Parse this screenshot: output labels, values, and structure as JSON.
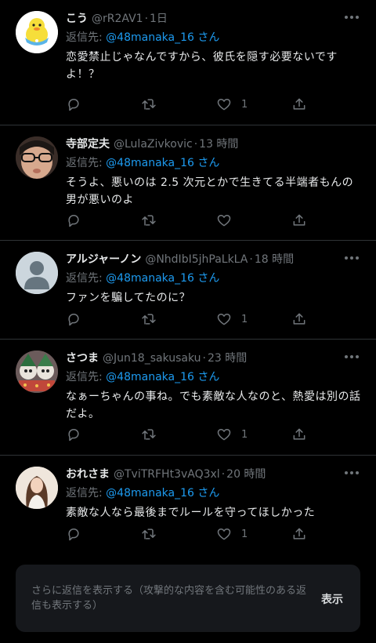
{
  "replies": [
    {
      "name": "こう",
      "handle": "@rR2AV1",
      "time": "1日",
      "reply_to_prefix": "返信先:",
      "reply_to": "@48manaka_16",
      "reply_to_suffix": "さん",
      "text": "恋愛禁止じゃなんですから、彼氏を隠す必要ないですよ！？",
      "likes": "1",
      "avatar": "duck-avatar"
    },
    {
      "name": "寺部定夫",
      "handle": "@LulaZivkovic",
      "time": "13 時間",
      "reply_to_prefix": "返信先:",
      "reply_to": "@48manaka_16",
      "reply_to_suffix": "さん",
      "text": "そうよ、悪いのは 2.5 次元とかで生きてる半端者もんの男が悪いのよ",
      "likes": "",
      "avatar": "photo-avatar"
    },
    {
      "name": "アルジャーノン",
      "handle": "@NhdIbI5jhPaLkLA",
      "time": "18 時間",
      "reply_to_prefix": "返信先:",
      "reply_to": "@48manaka_16",
      "reply_to_suffix": "さん",
      "text": "ファンを騙してたのに？",
      "likes": "1",
      "avatar": "default-avatar"
    },
    {
      "name": "さつま",
      "handle": "@Jun18_sakusaku",
      "time": "23 時間",
      "reply_to_prefix": "返信先:",
      "reply_to": "@48manaka_16",
      "reply_to_suffix": "さん",
      "text": "なぁーちゃんの事ね。でも素敵な人なのと、熱愛は別の話だよ。",
      "likes": "1",
      "avatar": "figurines-avatar"
    },
    {
      "name": "おれさま",
      "handle": "@TviTRFHt3vAQ3xl",
      "time": "20 時間",
      "reply_to_prefix": "返信先:",
      "reply_to": "@48manaka_16",
      "reply_to_suffix": "さん",
      "text": "素敵な人なら最後までルールを守ってほしかった",
      "likes": "1",
      "avatar": "person-avatar"
    }
  ],
  "more_replies": {
    "label": "さらに返信を表示する（攻撃的な内容を含む可能性のある返信も表示する）",
    "button": "表示"
  },
  "colors": {
    "background": "#000000",
    "text": "#e7e9ea",
    "muted": "#71767b",
    "link": "#1d9bf0",
    "divider": "#2f3336"
  }
}
